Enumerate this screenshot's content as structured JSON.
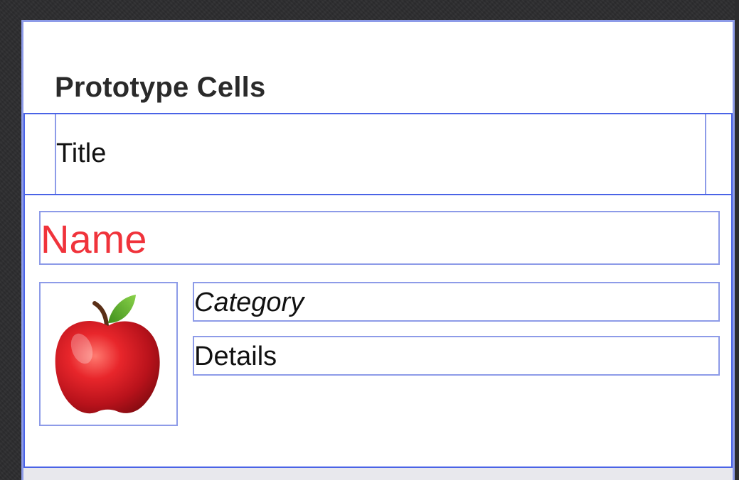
{
  "table": {
    "section_header": "Prototype Cells",
    "basic_cell": {
      "title": "Title"
    },
    "custom_cell": {
      "name": "Name",
      "image_icon": "apple-icon",
      "category": "Category",
      "details": "Details"
    }
  },
  "colors": {
    "selection_outline": "#4a63e6",
    "view_outline": "#8d9be8",
    "name_text": "#f0333b",
    "background": "#2c2c2e"
  }
}
